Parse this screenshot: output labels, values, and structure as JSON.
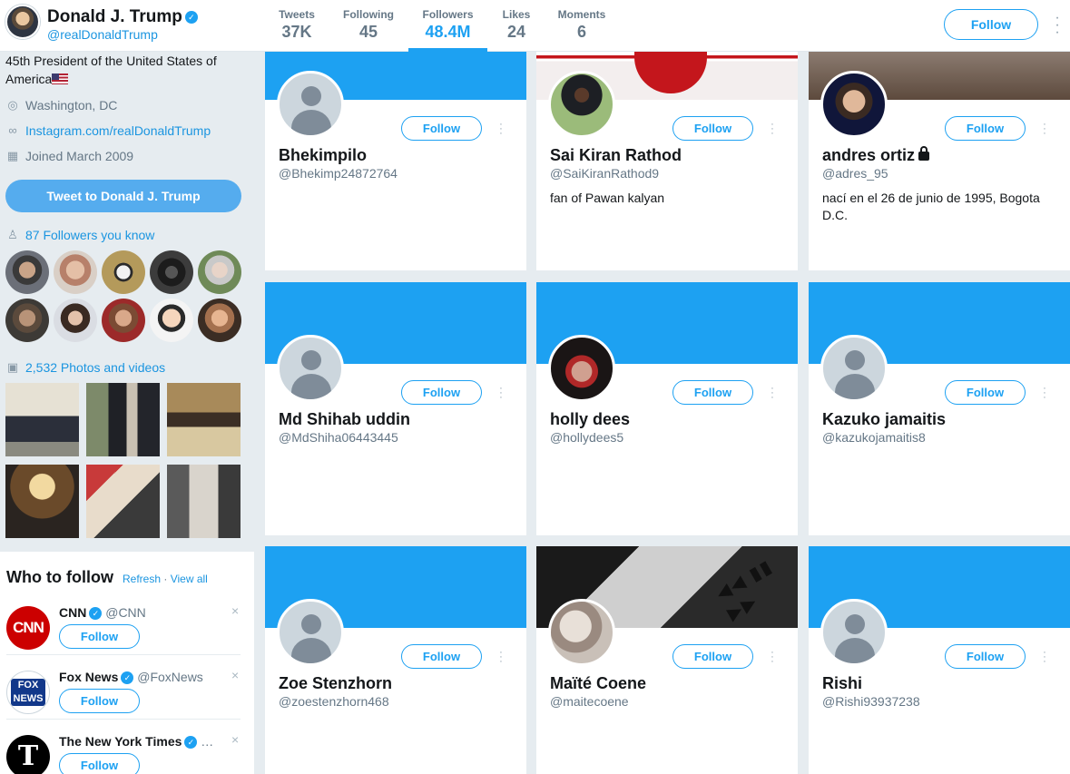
{
  "profile": {
    "name": "Donald J. Trump",
    "handle": "@realDonaldTrump",
    "bio": "45th President of the United States of America",
    "location": "Washington, DC",
    "website": "Instagram.com/realDonaldTrump",
    "joined": "Joined March 2009",
    "tweet_to_label": "Tweet to Donald J. Trump",
    "followers_you_know": "87 Followers you know",
    "photos_videos": "2,532 Photos and videos"
  },
  "nav": {
    "stats": [
      {
        "label": "Tweets",
        "value": "37K"
      },
      {
        "label": "Following",
        "value": "45"
      },
      {
        "label": "Followers",
        "value": "48.4M"
      },
      {
        "label": "Likes",
        "value": "24"
      },
      {
        "label": "Moments",
        "value": "6"
      }
    ],
    "follow_label": "Follow"
  },
  "who_to_follow": {
    "title": "Who to follow",
    "refresh": "Refresh",
    "separator": "·",
    "view_all": "View all",
    "accounts": [
      {
        "name": "CNN",
        "handle": "@CNN",
        "button": "Follow"
      },
      {
        "name": "Fox News",
        "handle": "@FoxNews",
        "button": "Follow"
      },
      {
        "name": "The New York Times",
        "handle": "…",
        "button": "Follow"
      }
    ]
  },
  "followers": [
    {
      "name": "Bhekimpilo",
      "handle": "@Bhekimp24872764",
      "bio": "",
      "button": "Follow"
    },
    {
      "name": "Sai Kiran Rathod",
      "handle": "@SaiKiranRathod9",
      "bio": "fan of Pawan kalyan",
      "button": "Follow"
    },
    {
      "name": "andres ortiz",
      "handle": "@adres_95",
      "bio": "nací en el 26 de junio de 1995, Bogota D.C.",
      "button": "Follow"
    },
    {
      "name": "Md Shihab uddin",
      "handle": "@MdShiha06443445",
      "bio": "",
      "button": "Follow"
    },
    {
      "name": "holly dees",
      "handle": "@hollydees5",
      "bio": "",
      "button": "Follow"
    },
    {
      "name": "Kazuko jamaitis",
      "handle": "@kazukojamaitis8",
      "bio": "",
      "button": "Follow"
    },
    {
      "name": "Zoe Stenzhorn",
      "handle": "@zoestenzhorn468",
      "bio": "",
      "button": "Follow"
    },
    {
      "name": "Maïté Coene",
      "handle": "@maitecoene",
      "bio": "",
      "button": "Follow"
    },
    {
      "name": "Rishi",
      "handle": "@Rishi93937238",
      "bio": "",
      "button": "Follow"
    }
  ],
  "colors": {
    "accent": "#1da1f2",
    "link": "#1b95e0",
    "background": "#e6ecf0"
  }
}
